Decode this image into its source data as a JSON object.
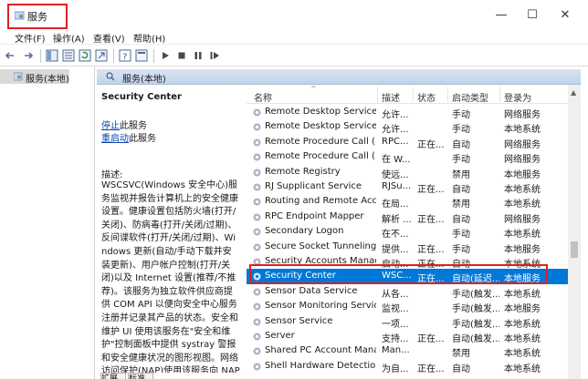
{
  "window": {
    "title": "服务",
    "minimize_glyph": "—",
    "maximize_glyph": "☐",
    "close_glyph": "✕"
  },
  "menu": [
    "文件(F)",
    "操作(A)",
    "查看(V)",
    "帮助(H)"
  ],
  "toolbar_icons": [
    "back-arrow-icon",
    "forward-arrow-icon",
    "show-hide-tree-icon",
    "list-view-icon",
    "refresh-icon",
    "export-list-icon",
    "help-icon",
    "properties-icon",
    "start-icon",
    "stop-icon",
    "pause-icon",
    "restart-icon"
  ],
  "tree": {
    "item": "服务(本地)"
  },
  "panel": {
    "header": "服务(本地)"
  },
  "description": {
    "service_name": "Security Center",
    "stop_link": "停止",
    "stop_suffix": "此服务",
    "restart_link": "重启动",
    "restart_suffix": "此服务",
    "label": "描述:",
    "text": "WSCSVC(Windows 安全中心)服务监视并报告计算机上的安全健康设置。健康设置包括防火墙(打开/关闭)、防病毒(打开/关闭/过期)、反间谍软件(打开/关闭/过期)、Windows 更新(自动/手动下载并安装更新)、用户帐户控制(打开/关闭)以及 Internet 设置(推荐/不推荐)。该服务为独立软件供应商提供 COM API 以便向安全中心服务注册并记录其产品的状态。安全和维护 UI 使用该服务在\"安全和维护\"控制面板中提供 systray 警报和安全健康状况的图形视图。网络访问保护(NAP)使用该服务向 NAP 网络策略服务器报告客户端的安全"
  },
  "tabs": [
    "扩展",
    "标准"
  ],
  "columns": [
    "名称",
    "描述",
    "状态",
    "启动类型",
    "登录为"
  ],
  "services": [
    {
      "name": "Remote Desktop Services",
      "desc": "允许...",
      "status": "",
      "startup": "手动",
      "logon": "网络服务"
    },
    {
      "name": "Remote Desktop Services ...",
      "desc": "允许...",
      "status": "",
      "startup": "手动",
      "logon": "本地系统"
    },
    {
      "name": "Remote Procedure Call (...",
      "desc": "RPC...",
      "status": "正在...",
      "startup": "自动",
      "logon": "网络服务"
    },
    {
      "name": "Remote Procedure Call (...",
      "desc": "在 W...",
      "status": "",
      "startup": "手动",
      "logon": "网络服务"
    },
    {
      "name": "Remote Registry",
      "desc": "使远...",
      "status": "",
      "startup": "禁用",
      "logon": "本地服务"
    },
    {
      "name": "RJ Supplicant Service",
      "desc": "RJSu...",
      "status": "正在...",
      "startup": "自动",
      "logon": "本地系统"
    },
    {
      "name": "Routing and Remote Acc...",
      "desc": "在局...",
      "status": "",
      "startup": "禁用",
      "logon": "本地系统"
    },
    {
      "name": "RPC Endpoint Mapper",
      "desc": "解析 ...",
      "status": "正在...",
      "startup": "自动",
      "logon": "网络服务"
    },
    {
      "name": "Secondary Logon",
      "desc": "在不...",
      "status": "",
      "startup": "手动",
      "logon": "本地系统"
    },
    {
      "name": "Secure Socket Tunneling ...",
      "desc": "提供...",
      "status": "正在...",
      "startup": "手动",
      "logon": "本地服务"
    },
    {
      "name": "Security Accounts Manag...",
      "desc": "启动...",
      "status": "正在...",
      "startup": "自动",
      "logon": "本地系统"
    },
    {
      "name": "Security Center",
      "desc": "WSC...",
      "status": "正在...",
      "startup": "自动(延迟...",
      "logon": "本地服务"
    },
    {
      "name": "Sensor Data Service",
      "desc": "从各...",
      "status": "",
      "startup": "手动(触发...",
      "logon": "本地系统"
    },
    {
      "name": "Sensor Monitoring Service",
      "desc": "监视...",
      "status": "",
      "startup": "手动(触发...",
      "logon": "本地服务"
    },
    {
      "name": "Sensor Service",
      "desc": "一项...",
      "status": "",
      "startup": "手动(触发...",
      "logon": "本地系统"
    },
    {
      "name": "Server",
      "desc": "支持...",
      "status": "正在...",
      "startup": "自动(触发...",
      "logon": "本地系统"
    },
    {
      "name": "Shared PC Account Mana...",
      "desc": "Man...",
      "status": "",
      "startup": "禁用",
      "logon": "本地系统"
    },
    {
      "name": "Shell Hardware Detection",
      "desc": "为自...",
      "status": "正在...",
      "startup": "自动",
      "logon": "本地系统"
    }
  ],
  "selected_index": 11,
  "colors": {
    "highlight_red": "#e02020",
    "selection_blue": "#0078d7",
    "link_blue": "#0645ad"
  }
}
